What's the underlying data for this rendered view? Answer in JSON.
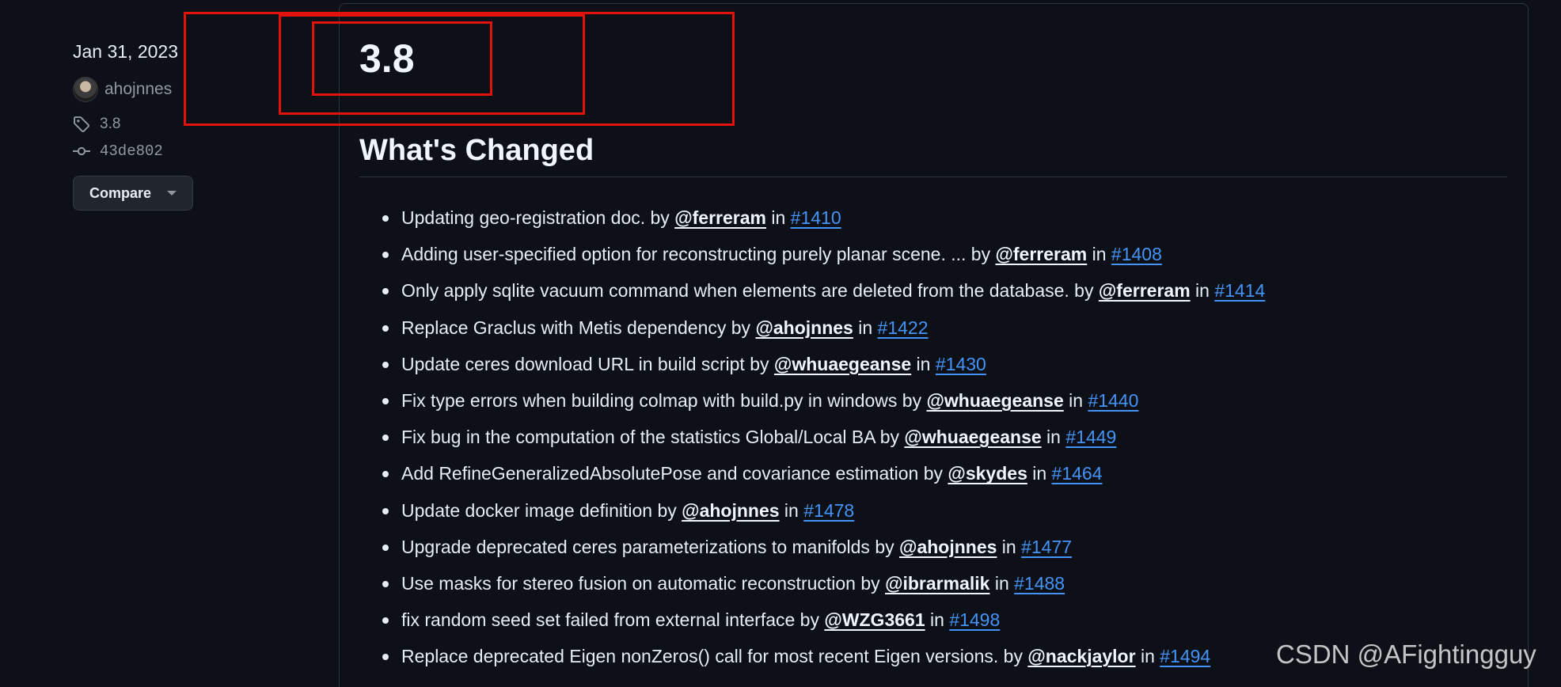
{
  "release": {
    "date": "Jan 31, 2023",
    "author": "ahojnnes",
    "tag": "3.8",
    "commit": "43de802",
    "compare_label": "Compare",
    "title": "3.8",
    "section_title": "What's Changed"
  },
  "changes": [
    {
      "text": "Updating geo-registration doc. by ",
      "user": "@ferreram",
      "in": " in ",
      "pr": "#1410"
    },
    {
      "text": "Adding user-specified option for reconstructing purely planar scene. ... by ",
      "user": "@ferreram",
      "in": " in ",
      "pr": "#1408"
    },
    {
      "text": "Only apply sqlite vacuum command when elements are deleted from the database. by ",
      "user": "@ferreram",
      "in": " in ",
      "pr": "#1414"
    },
    {
      "text": "Replace Graclus with Metis dependency by ",
      "user": "@ahojnnes",
      "in": " in ",
      "pr": "#1422"
    },
    {
      "text": "Update ceres download URL in build script by ",
      "user": "@whuaegeanse",
      "in": " in ",
      "pr": "#1430"
    },
    {
      "text": "Fix type errors when building colmap with build.py in windows by ",
      "user": "@whuaegeanse",
      "in": " in ",
      "pr": "#1440"
    },
    {
      "text": "Fix bug in the computation of the statistics Global/Local BA by ",
      "user": "@whuaegeanse",
      "in": " in ",
      "pr": "#1449"
    },
    {
      "text": "Add RefineGeneralizedAbsolutePose and covariance estimation by ",
      "user": "@skydes",
      "in": " in ",
      "pr": "#1464"
    },
    {
      "text": "Update docker image definition by ",
      "user": "@ahojnnes",
      "in": " in ",
      "pr": "#1478"
    },
    {
      "text": "Upgrade deprecated ceres parameterizations to manifolds by ",
      "user": "@ahojnnes",
      "in": " in ",
      "pr": "#1477"
    },
    {
      "text": "Use masks for stereo fusion on automatic reconstruction by ",
      "user": "@ibrarmalik",
      "in": " in ",
      "pr": "#1488"
    },
    {
      "text": "fix random seed set failed from external interface by ",
      "user": "@WZG3661",
      "in": " in ",
      "pr": "#1498"
    },
    {
      "text": "Replace deprecated Eigen nonZeros() call for most recent Eigen versions. by ",
      "user": "@nackjaylor",
      "in": " in ",
      "pr": "#1494"
    }
  ],
  "watermark": "CSDN @AFightingguy",
  "colors": {
    "background": "#0d1117",
    "link": "#4493f8",
    "annotation": "#e3120b"
  }
}
